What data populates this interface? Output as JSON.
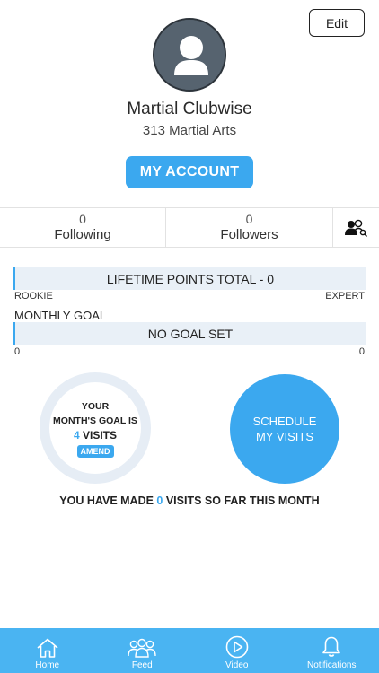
{
  "header": {
    "edit_label": "Edit"
  },
  "profile": {
    "avatar_icon": "user-silhouette-icon",
    "name": "Martial Clubwise",
    "club": "313 Martial Arts",
    "my_account_label": "MY ACCOUNT"
  },
  "stats": {
    "following_count": "0",
    "following_label": "Following",
    "followers_count": "0",
    "followers_label": "Followers",
    "search_icon": "user-search-icon"
  },
  "points": {
    "bar_label": "LIFETIME POINTS TOTAL - 0",
    "min_label": "ROOKIE",
    "max_label": "EXPERT",
    "progress": 0
  },
  "monthly_goal": {
    "title": "MONTHLY GOAL",
    "bar_label": "NO GOAL SET",
    "min_value": "0",
    "max_value": "0",
    "progress": 0
  },
  "goal_circle": {
    "line1": "YOUR",
    "line2": "MONTH'S GOAL IS",
    "visits_number": "4",
    "visits_word": " VISITS",
    "amend_label": "AMEND"
  },
  "schedule": {
    "line1": "SCHEDULE",
    "line2": "MY VISITS"
  },
  "visits_made": {
    "prefix": "YOU HAVE MADE ",
    "count": "0",
    "suffix": " VISITS SO FAR THIS MONTH"
  },
  "tabs": [
    {
      "label": "Home",
      "icon": "home-icon"
    },
    {
      "label": "Feed",
      "icon": "group-icon"
    },
    {
      "label": "Video",
      "icon": "play-icon"
    },
    {
      "label": "Notifications",
      "icon": "bell-icon"
    }
  ],
  "colors": {
    "accent": "#3ba8ef",
    "tab_bar": "#4ab4f2",
    "bar_fill": "#e9f0f7",
    "avatar_bg": "#56636f"
  }
}
